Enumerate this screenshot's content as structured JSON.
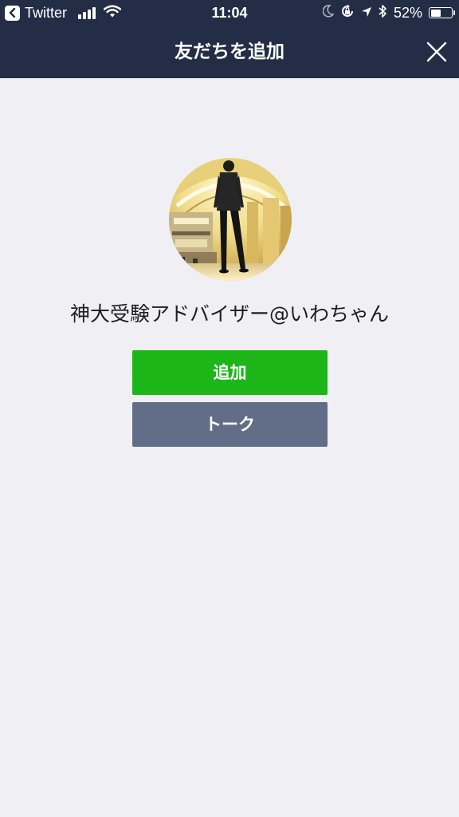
{
  "status_bar": {
    "back_app": "Twitter",
    "time": "11:04",
    "battery_percent": "52%",
    "battery_level": 0.52
  },
  "header": {
    "title": "友だちを追加"
  },
  "profile": {
    "name": "神大受験アドバイザー@いわちゃん"
  },
  "actions": {
    "add_label": "追加",
    "talk_label": "トーク"
  },
  "colors": {
    "header_bg": "#232e46",
    "page_bg": "#f0eff4",
    "add_button": "#1db619",
    "talk_button": "#626e88"
  },
  "icons": [
    "back-arrow-icon",
    "signal-icon",
    "wifi-icon",
    "moon-icon",
    "rotation-lock-icon",
    "location-icon",
    "bluetooth-icon",
    "battery-icon",
    "close-icon"
  ]
}
